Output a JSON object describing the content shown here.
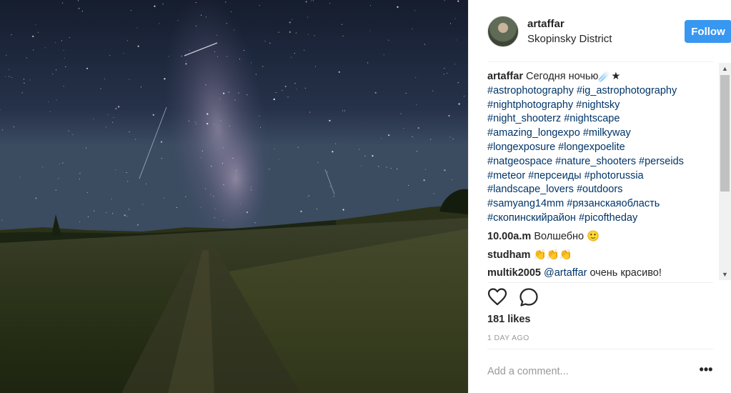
{
  "photo": {
    "subject": "milky-way-night-road",
    "colors": {
      "sky_top": "#1c2638",
      "sky_horizon": "#3a4a62",
      "field": "#2e331f"
    }
  },
  "header": {
    "username": "artaffar",
    "location": "Skopinsky District",
    "follow_label": "Follow",
    "follow_color": "#3897f0"
  },
  "comments": [
    {
      "user": "artaffar",
      "text": "Сегодня ночью☄️★",
      "tags": [
        "#astrophotography #ig_astrophotography",
        "#nightphotography #nightsky",
        "#night_shooterz #nightscape",
        "#amazing_longexpo #milkyway",
        "#longexposure #longexpoelite",
        "#natgeospace #nature_shooters #perseids",
        "#meteor #персеиды #photorussia",
        "#landscape_lovers #outdoors",
        "#samyang14mm #рязанскаяобласть",
        "#скопинскийрайон #picoftheday"
      ]
    },
    {
      "user": "10.00a.m",
      "text": "Волшебно 🙂"
    },
    {
      "user": "studham",
      "text": "👏👏👏"
    },
    {
      "user": "multik2005",
      "mention": "@artaffar",
      "text": "очень красиво!"
    }
  ],
  "actions": {
    "like_icon": "heart-icon",
    "comment_icon": "comment-bubble-icon"
  },
  "likes": "181 likes",
  "time": "1 DAY AGO",
  "add_comment": {
    "placeholder": "Add a comment...",
    "more_label": "•••"
  }
}
